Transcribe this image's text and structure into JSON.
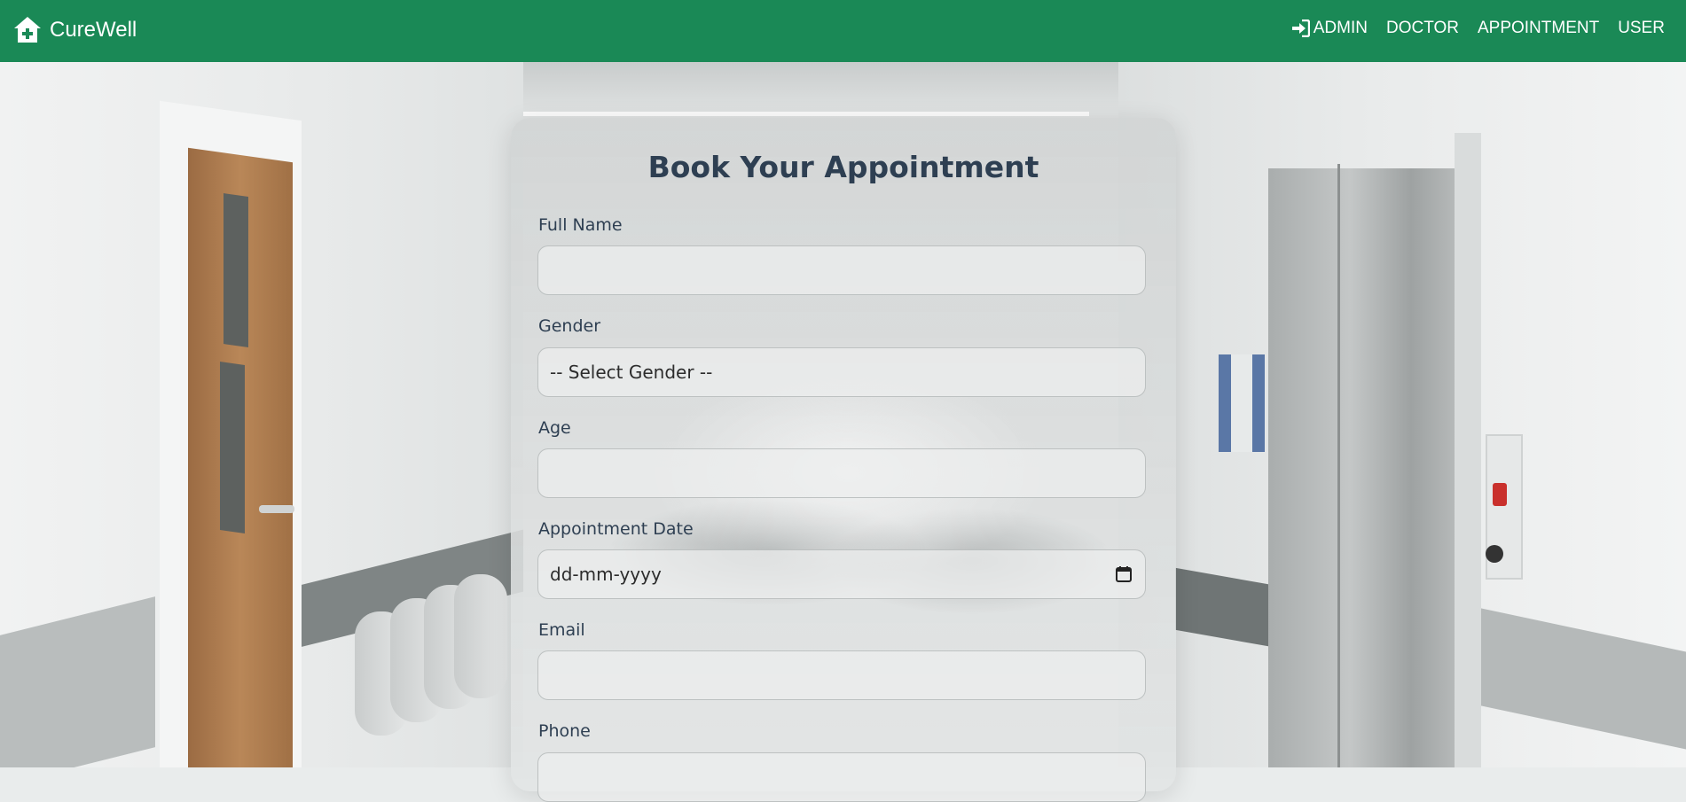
{
  "brand": {
    "name": "CureWell",
    "icon": "house-medical-icon"
  },
  "nav": {
    "items": [
      {
        "label": "ADMIN",
        "icon": "sign-in-icon"
      },
      {
        "label": "DOCTOR"
      },
      {
        "label": "APPOINTMENT"
      },
      {
        "label": "USER"
      }
    ]
  },
  "form": {
    "title": "Book Your Appointment",
    "full_name": {
      "label": "Full Name",
      "value": ""
    },
    "gender": {
      "label": "Gender",
      "selected": "-- Select Gender --"
    },
    "age": {
      "label": "Age",
      "value": ""
    },
    "date": {
      "label": "Appointment Date",
      "placeholder": "dd-mm-yyyy",
      "icon": "calendar-icon"
    },
    "email": {
      "label": "Email",
      "value": ""
    },
    "phone": {
      "label": "Phone",
      "value": ""
    }
  },
  "colors": {
    "navbar": "#1a8956",
    "title": "#2e3f52"
  }
}
